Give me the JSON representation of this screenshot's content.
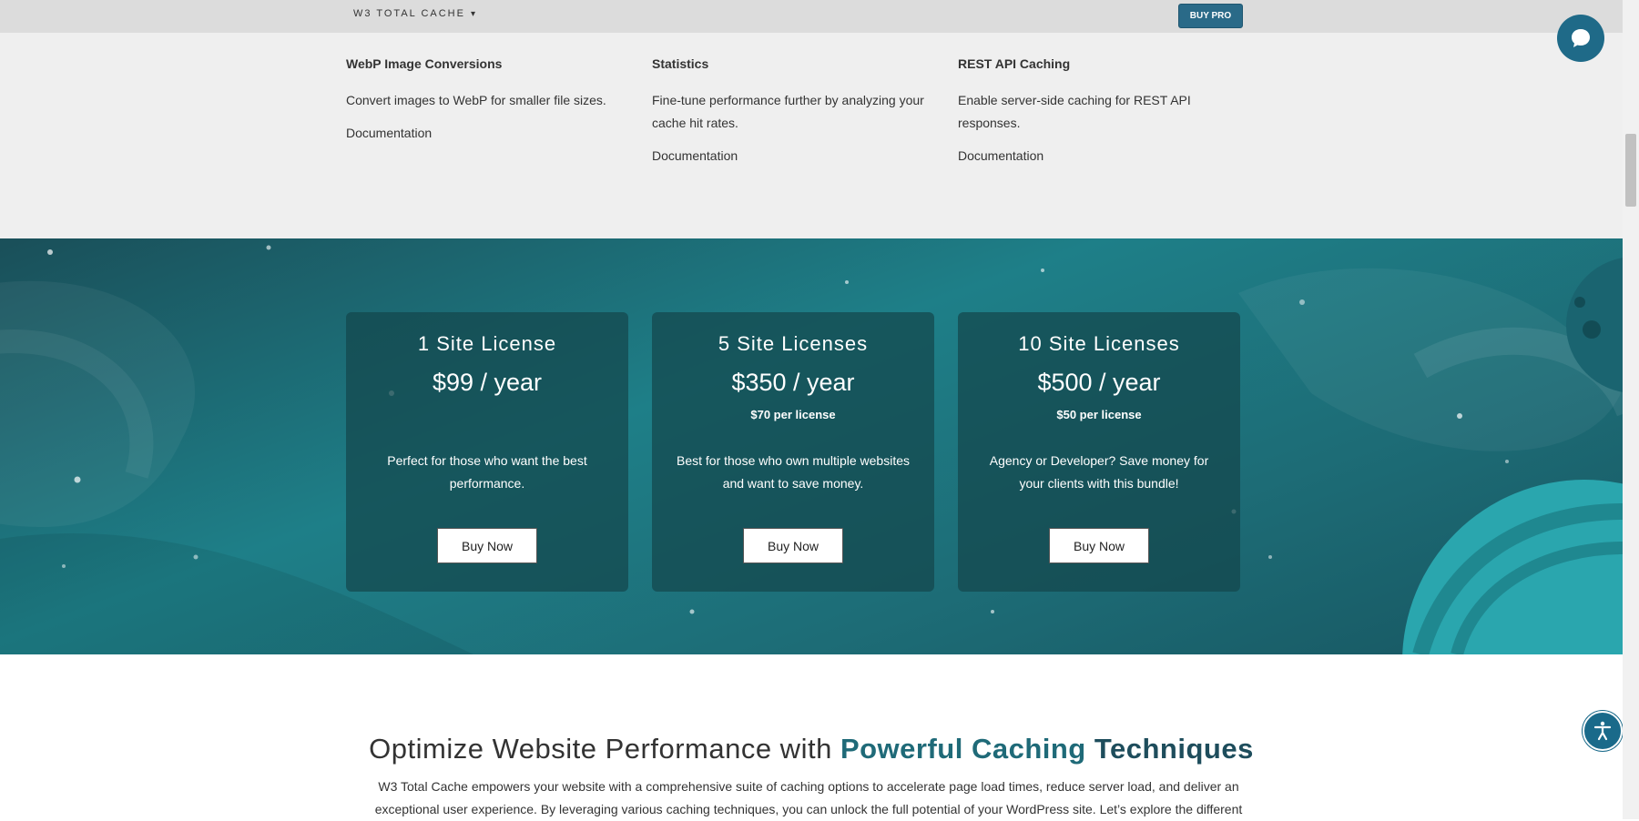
{
  "topbar": {
    "brand": "W3 TOTAL CACHE",
    "caret": "▾",
    "buy_pro": "BUY PRO"
  },
  "features": [
    {
      "title": "WebP Image Conversions",
      "description": "Convert images to WebP for smaller file sizes.",
      "link": "Documentation"
    },
    {
      "title": "Statistics",
      "description": "Fine-tune performance further by analyzing your cache hit rates.",
      "link": "Documentation"
    },
    {
      "title": "REST API Caching",
      "description": "Enable server-side caching for REST API responses.",
      "link": "Documentation"
    }
  ],
  "pricing": [
    {
      "title": "1 Site License",
      "price": "$99 / year",
      "per_license": "",
      "description": "Perfect for those who want the best performance.",
      "button": "Buy Now"
    },
    {
      "title": "5 Site Licenses",
      "price": "$350 / year",
      "per_license": "$70 per license",
      "description": "Best for those who own multiple websites and want to save money.",
      "button": "Buy Now"
    },
    {
      "title": "10 Site Licenses",
      "price": "$500 / year",
      "per_license": "$50 per license",
      "description": "Agency or Developer? Save money for your clients with this bundle!",
      "button": "Buy Now"
    }
  ],
  "optimize": {
    "heading_plain": "Optimize Website Performance with ",
    "heading_highlight_1": "Powerful Caching",
    "heading_highlight_2": "Techniques",
    "intro": "W3 Total Cache empowers your website with a comprehensive suite of caching options to accelerate page load times, reduce server load, and deliver an exceptional user experience. By leveraging various caching techniques, you can unlock the full potential of your WordPress site. Let’s explore the different"
  },
  "colors": {
    "topbar_bg": "#dcdcdc",
    "buy_pro_bg": "#2a6a88",
    "features_bg": "#efefef",
    "pricing_teal": "#1e7f88",
    "heading_highlight": "#1f6a78",
    "chat_bubble": "#1f6a88"
  },
  "icons": {
    "chat": "chat-bubble-icon",
    "accessibility": "accessibility-icon"
  }
}
